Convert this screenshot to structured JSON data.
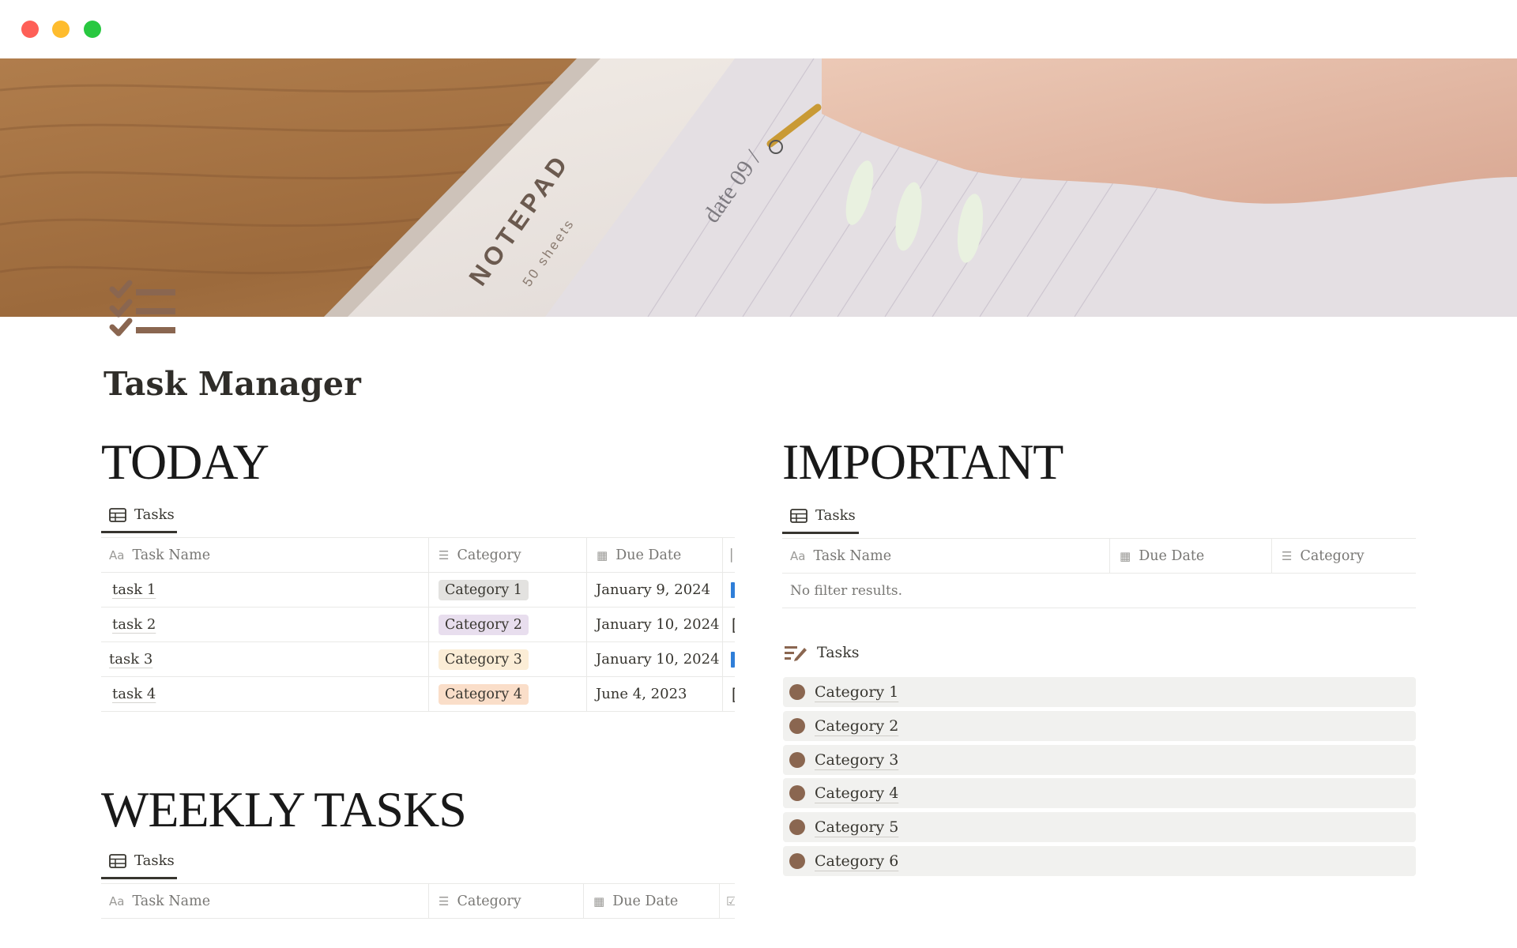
{
  "window": {
    "controls": [
      "close",
      "minimize",
      "zoom"
    ]
  },
  "page": {
    "title": "Task Manager",
    "icon": "checklist-icon",
    "accent_color": "#8a6650"
  },
  "today": {
    "heading": "TODAY",
    "view_label": "Tasks",
    "columns": [
      "Task Name",
      "Category",
      "Due Date"
    ],
    "rows": [
      {
        "name": "task 1",
        "category": "Category 1",
        "due": "January 9, 2024"
      },
      {
        "name": "task 2",
        "category": "Category 2",
        "due": "January 10, 2024"
      },
      {
        "name": "task 3",
        "category": "Category 3",
        "due": "January 10, 2024"
      },
      {
        "name": "task 4",
        "category": "Category 4",
        "due": "June 4, 2023"
      }
    ]
  },
  "weekly": {
    "heading": "WEEKLY TASKS",
    "view_label": "Tasks",
    "columns": [
      "Task Name",
      "Category",
      "Due Date"
    ]
  },
  "important": {
    "heading": "IMPORTANT",
    "view_label": "Tasks",
    "columns": [
      "Task Name",
      "Due Date",
      "Category"
    ],
    "empty_text": "No filter results."
  },
  "board": {
    "label": "Tasks",
    "groups": [
      "Category 1",
      "Category 2",
      "Category 3",
      "Category 4",
      "Category 5",
      "Category 6"
    ]
  },
  "tag_colors": {
    "Category 1": "#e3e2e0",
    "Category 2": "#e8deee",
    "Category 3": "#fbedd6",
    "Category 4": "#fadec9"
  },
  "cover": {
    "notepad_text": "NOTEPAD",
    "notepad_subtext": "50 sheets",
    "date_text": "date 09 /"
  }
}
